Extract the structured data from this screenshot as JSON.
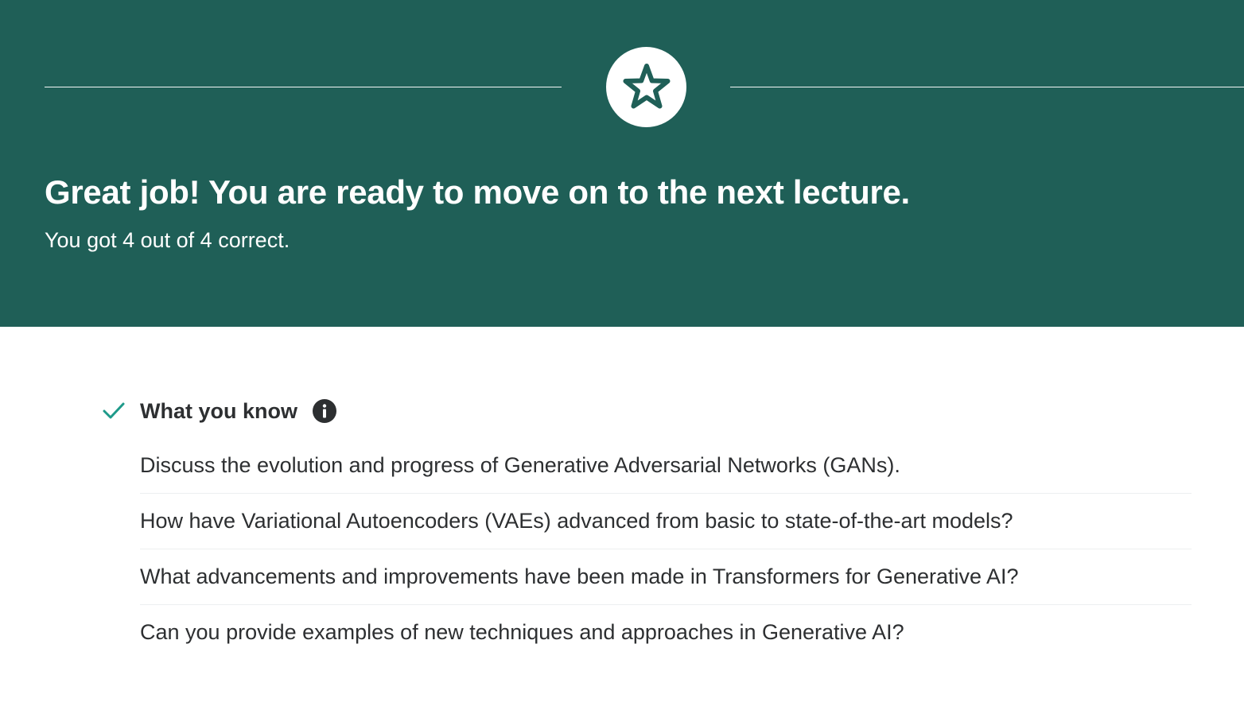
{
  "banner": {
    "background_color": "#1f5f57",
    "icon": "star-icon",
    "headline": "Great job! You are ready to move on to the next lecture.",
    "score_text": "You got 4 out of 4 correct."
  },
  "section": {
    "check_icon": "checkmark-icon",
    "check_color": "#1e9a8a",
    "title": "What you know",
    "info_icon": "info-icon",
    "items": [
      "Discuss the evolution and progress of Generative Adversarial Networks (GANs).",
      "How have Variational Autoencoders (VAEs) advanced from basic to state-of-the-art models?",
      "What advancements and improvements have been made in Transformers for Generative AI?",
      "Can you provide examples of new techniques and approaches in Generative AI?"
    ]
  }
}
